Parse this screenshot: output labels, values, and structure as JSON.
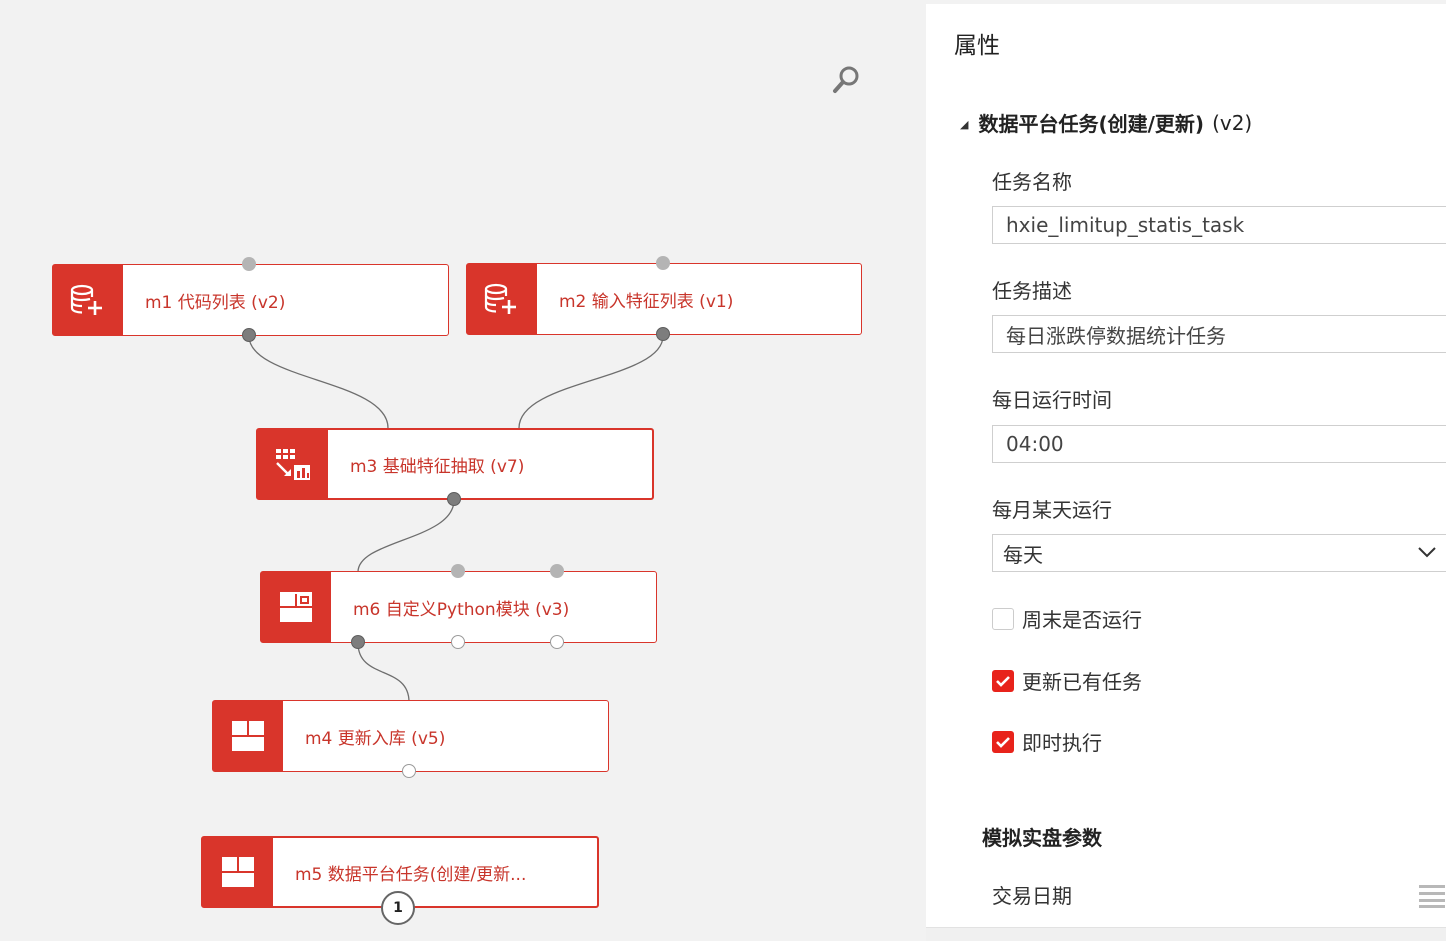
{
  "canvas": {
    "nodes": [
      {
        "id": "m1",
        "label": "m1 代码列表 (v2)",
        "icon": "database-add-icon"
      },
      {
        "id": "m2",
        "label": "m2 输入特征列表 (v1)",
        "icon": "database-add-icon"
      },
      {
        "id": "m3",
        "label": "m3 基础特征抽取 (v7)",
        "icon": "grid-chart-icon"
      },
      {
        "id": "m6",
        "label": "m6 自定义Python模块 (v3)",
        "icon": "module-icon"
      },
      {
        "id": "m4",
        "label": "m4 更新入库 (v5)",
        "icon": "module-icon"
      },
      {
        "id": "m5",
        "label": "m5 数据平台任务(创建/更新...",
        "icon": "module-icon"
      }
    ],
    "badge": "1",
    "zoom_icon": "search-icon"
  },
  "panel": {
    "title": "属性",
    "section": {
      "title": "数据平台任务(创建/更新)",
      "version": "(v2)",
      "expanded": true
    },
    "fields": {
      "task_name": {
        "label": "任务名称",
        "value": "hxie_limitup_statis_task"
      },
      "task_desc": {
        "label": "任务描述",
        "value": "每日涨跌停数据统计任务"
      },
      "daily_time": {
        "label": "每日运行时间",
        "value": "04:00"
      },
      "monthly_day": {
        "label": "每月某天运行",
        "value": "每天"
      }
    },
    "checkboxes": {
      "weekend": {
        "label": "周末是否运行",
        "checked": false
      },
      "update_existing": {
        "label": "更新已有任务",
        "checked": true
      },
      "run_now": {
        "label": "即时执行",
        "checked": true
      }
    },
    "sim_section": "模拟实盘参数",
    "trade_date_label": "交易日期",
    "colors": {
      "accent": "#d9352b",
      "checkbox": "#e8231b"
    }
  }
}
